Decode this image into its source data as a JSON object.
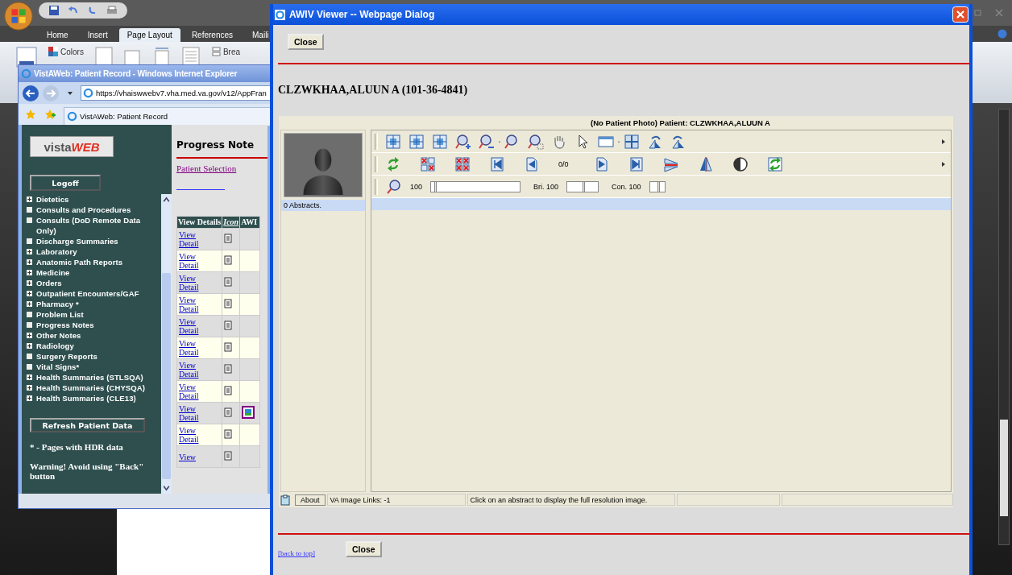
{
  "word": {
    "tabs": [
      {
        "label": "Home",
        "selected": false
      },
      {
        "label": "Insert",
        "selected": false
      },
      {
        "label": "Page Layout",
        "selected": true
      },
      {
        "label": "References",
        "selected": false
      },
      {
        "label": "Maili",
        "selected": false
      }
    ],
    "colors_button": "Colors",
    "breaks_button": "Brea"
  },
  "browser": {
    "title": "VistAWeb: Patient Record - Windows Internet Explorer",
    "url": "https://vhaiswwebv7.vha.med.va.gov/v12/AppFran",
    "tab": "VistAWeb: Patient Record"
  },
  "sidebar": {
    "logo_main": "vista",
    "logo_accent": "WEB",
    "logoff": "Logoff",
    "items": [
      {
        "label": "Dietetics",
        "expandable": true
      },
      {
        "label": "Consults and Procedures",
        "expandable": false
      },
      {
        "label": "Consults (DoD Remote Data Only)",
        "expandable": false
      },
      {
        "label": "Discharge Summaries",
        "expandable": false
      },
      {
        "label": "Laboratory",
        "expandable": true
      },
      {
        "label": "Anatomic Path Reports",
        "expandable": true
      },
      {
        "label": "Medicine",
        "expandable": true
      },
      {
        "label": "Orders",
        "expandable": true
      },
      {
        "label": "Outpatient Encounters/GAF",
        "expandable": true
      },
      {
        "label": "Pharmacy *",
        "expandable": true
      },
      {
        "label": "Problem List",
        "expandable": false
      },
      {
        "label": "Progress Notes",
        "expandable": false
      },
      {
        "label": "Other Notes",
        "expandable": true
      },
      {
        "label": "Radiology",
        "expandable": true
      },
      {
        "label": "Surgery Reports",
        "expandable": false
      },
      {
        "label": "Vital Signs*",
        "expandable": false
      },
      {
        "label": "Health Summaries (STLSQA)",
        "expandable": true
      },
      {
        "label": "Health Summaries (CHYSQA)",
        "expandable": true
      },
      {
        "label": "Health Summaries (CLE13)",
        "expandable": true
      }
    ],
    "refresh": "Refresh Patient Data",
    "hdr_note": "* - Pages with HDR data",
    "warning": "Warning! Avoid using \"Back\" button"
  },
  "content": {
    "title": "Progress Note",
    "patient_selection": "Patient Selection",
    "columns": [
      "View Details",
      "Icon",
      "AWI"
    ],
    "rows": [
      {
        "link": "View Detail",
        "has_image": false
      },
      {
        "link": "View Detail",
        "has_image": false
      },
      {
        "link": "View Detail",
        "has_image": false
      },
      {
        "link": "View Detail",
        "has_image": false
      },
      {
        "link": "View Detail",
        "has_image": false
      },
      {
        "link": "View Detail",
        "has_image": false
      },
      {
        "link": "View Detail",
        "has_image": false
      },
      {
        "link": "View Detail",
        "has_image": false
      },
      {
        "link": "View Detail",
        "has_image": true
      },
      {
        "link": "View Detail",
        "has_image": false
      },
      {
        "link": "View",
        "has_image": false
      }
    ]
  },
  "dialog": {
    "title": "AWIV Viewer -- Webpage Dialog",
    "close_top": "Close",
    "patient_heading": "CLZWKHAA,ALUUN A (101-36-4841)",
    "viewer": {
      "header": "(No Patient Photo) Patient: CLZWKHAA,ALUUN A",
      "abstracts": "0 Abstracts.",
      "page_counter": "0/0",
      "zoom": {
        "value": "100",
        "level": 0.04
      },
      "brightness": {
        "label": "Bri. 100",
        "level": 0.5
      },
      "contrast": {
        "label": "Con. 100",
        "level": 0.5
      },
      "about": "About",
      "image_links": "VA Image Links: -1",
      "message": "Click on an abstract to display the full resolution image."
    },
    "back_to_top": "[back to top]",
    "close_bottom": "Close"
  }
}
